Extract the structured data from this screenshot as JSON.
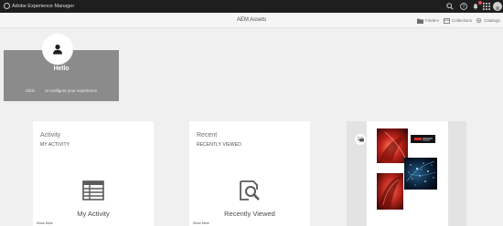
{
  "shell": {
    "app_title": "Adobe Experience Manager",
    "icons": [
      "search-icon",
      "help-icon",
      "bell-icon",
      "apps-icon",
      "user-avatar"
    ]
  },
  "header": {
    "title": "AEM Assets",
    "links": [
      {
        "label": "Folders",
        "icon": "folder-icon"
      },
      {
        "label": "Collections",
        "icon": "collections-icon"
      },
      {
        "label": "Catalogs",
        "icon": "gear-icon"
      }
    ]
  },
  "hello": {
    "title": "Hello",
    "msg_before": "Click",
    "msg_after": "to configure your experience",
    "color": "#8b8b8b"
  },
  "activity": {
    "title": "Activity",
    "subtitle": "MY ACTIVITY",
    "label": "My Activity",
    "more": "Show More",
    "icon": "table-icon"
  },
  "recent": {
    "title": "Recent",
    "subtitle": "RECENTLY VIEWED",
    "label": "Recently Viewed",
    "more": "Show More",
    "icon": "search-doc-icon"
  },
  "recent_assets": {
    "toggle_icon": "view-toggle-icon",
    "thumbnails": [
      "red-flower-image",
      "brand-banner-image",
      "particles-image",
      "red-tulip-image"
    ]
  },
  "colors": {
    "shell_bg": "#1e1e1e",
    "page_bg": "#f0f0f0",
    "hello_bg": "#8b8b8b",
    "notification": "#e34850"
  }
}
